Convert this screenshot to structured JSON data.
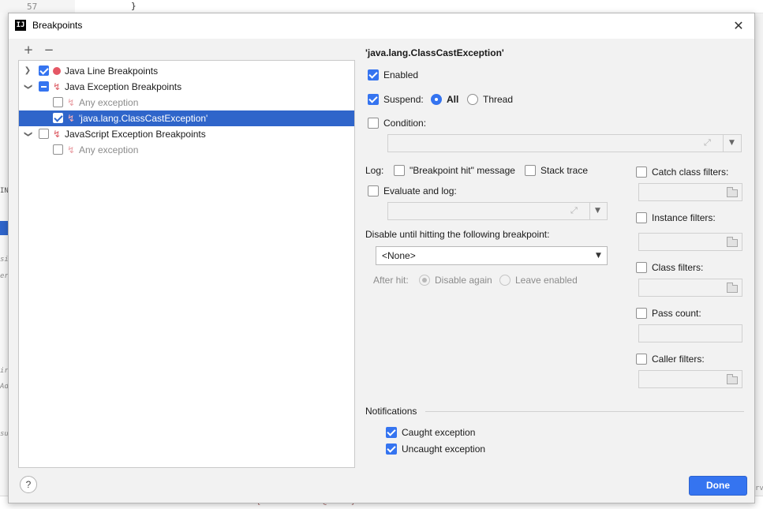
{
  "background": {
    "line_number": "57",
    "code_brace": "}",
    "bottom_code": "reflectionData = {SoftReference@23345}",
    "left_fragments": [
      "IN",
      "sis",
      "ers",
      "ir",
      "Ad",
      "su"
    ],
    "right_fragment": "rv"
  },
  "dialog": {
    "title": "Breakpoints",
    "app_logo": "IJ",
    "close_symbol": "✕",
    "toolbar": {
      "add": "+",
      "remove": "−"
    }
  },
  "tree": {
    "items": [
      {
        "label": "Java Line Breakpoints",
        "expanded": false,
        "checked": "checked",
        "icon": "red-dot-icon"
      },
      {
        "label": "Java Exception Breakpoints",
        "expanded": true,
        "checked": "partial",
        "icon": "lightning-icon"
      },
      {
        "label": "Any exception",
        "checked": "unchecked",
        "icon": "lightning-icon"
      },
      {
        "label": "'java.lang.ClassCastException'",
        "checked": "checked",
        "icon": "lightning-icon",
        "selected": true
      },
      {
        "label": "JavaScript Exception Breakpoints",
        "expanded": true,
        "checked": "unchecked",
        "icon": "lightning-icon"
      },
      {
        "label": "Any exception",
        "checked": "unchecked",
        "icon": "lightning-icon"
      }
    ]
  },
  "detail": {
    "heading": "'java.lang.ClassCastException'",
    "enabled_label": "Enabled",
    "suspend_label": "Suspend:",
    "suspend_all": "All",
    "suspend_thread": "Thread",
    "condition_label": "Condition:",
    "log_label": "Log:",
    "log_hit_message": "\"Breakpoint hit\" message",
    "log_stack_trace": "Stack trace",
    "evaluate_label": "Evaluate and log:",
    "disable_until_label": "Disable until hitting the following breakpoint:",
    "disable_until_value": "<None>",
    "after_hit_label": "After hit:",
    "after_hit_disable": "Disable again",
    "after_hit_leave": "Leave enabled",
    "catch_class_filters": "Catch class filters:",
    "instance_filters": "Instance filters:",
    "class_filters": "Class filters:",
    "pass_count": "Pass count:",
    "caller_filters": "Caller filters:",
    "notifications_label": "Notifications",
    "caught_exception": "Caught exception",
    "uncaught_exception": "Uncaught exception"
  },
  "footer": {
    "help": "?",
    "done": "Done"
  },
  "colors": {
    "accent": "#3574f0",
    "selection": "#2f65ca",
    "breakpoint_red": "#e55765"
  }
}
